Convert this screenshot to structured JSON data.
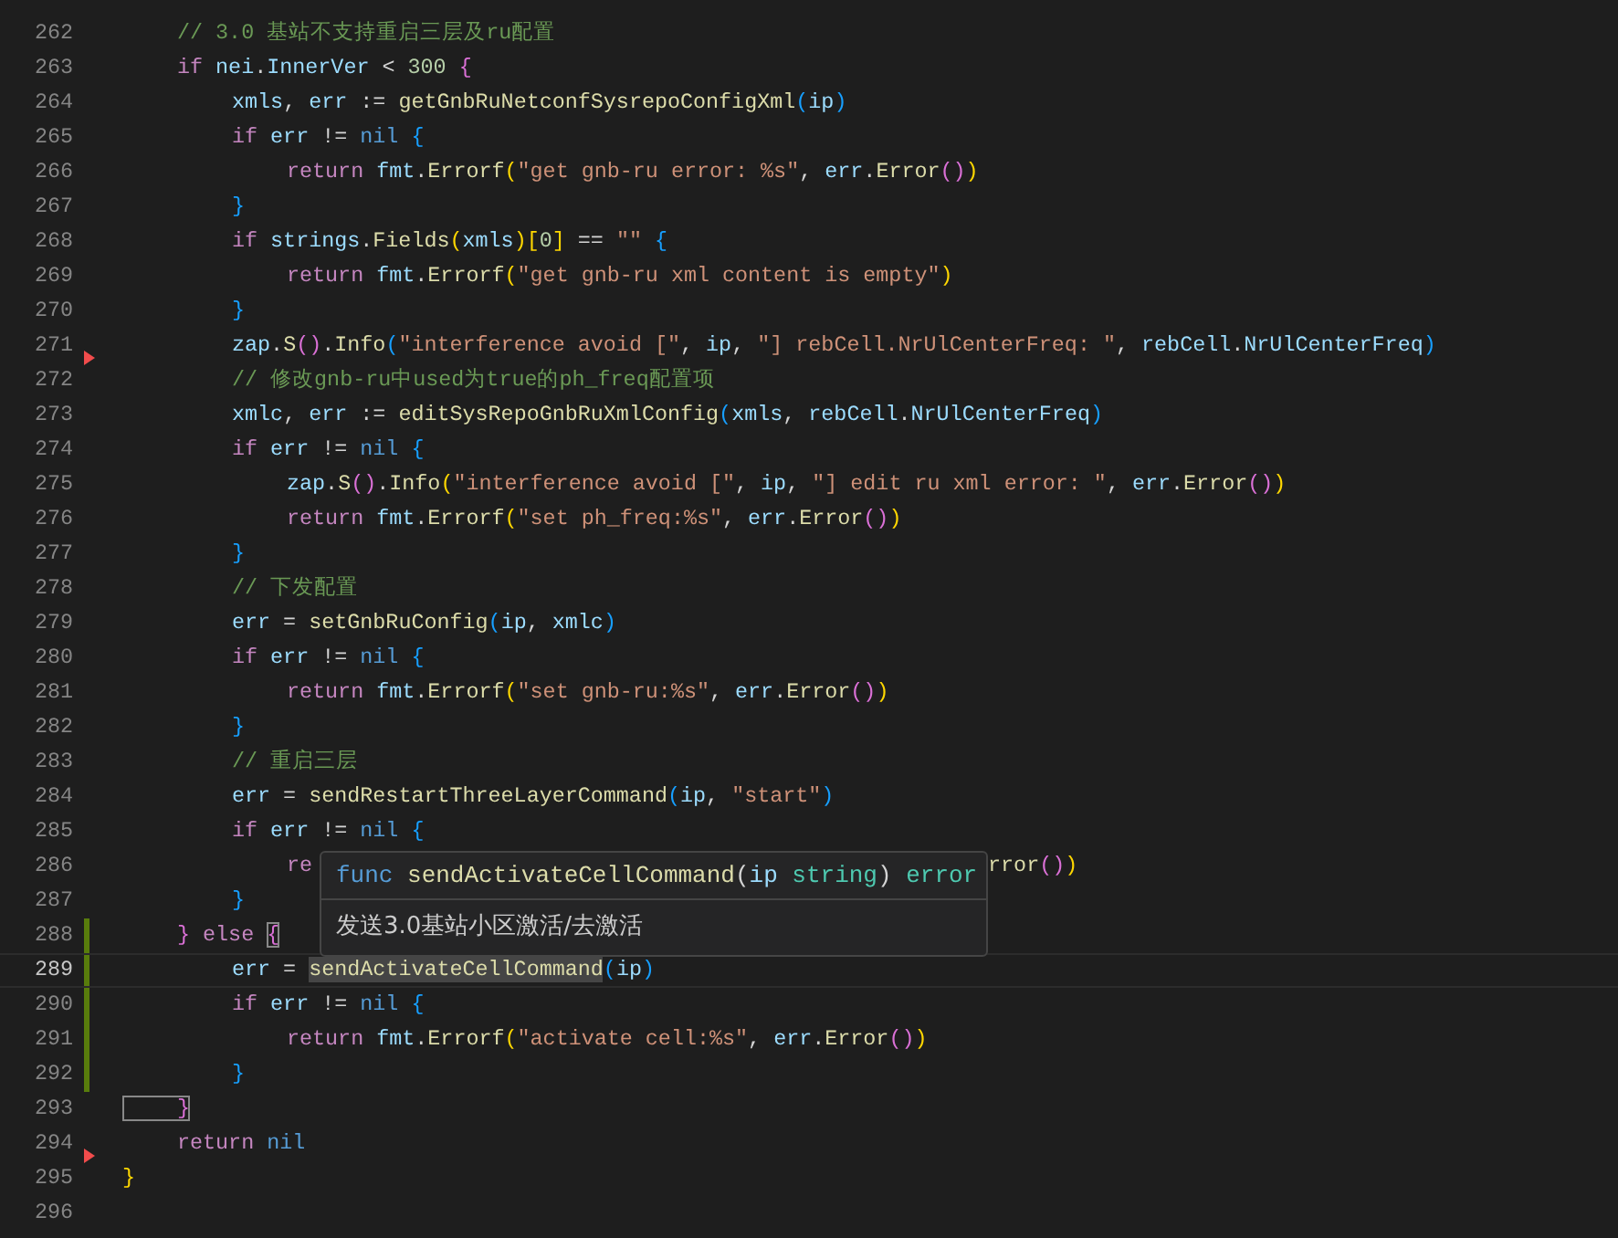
{
  "editor": {
    "lines": [
      {
        "number": "262",
        "current": false,
        "added": false,
        "deleted": false,
        "tokens": [
          {
            "kind": "cmt",
            "text": "\t// 3.0 基站不支持重启三层及ru配置"
          }
        ]
      },
      {
        "number": "263",
        "current": false,
        "added": false,
        "deleted": false,
        "tokens": [
          {
            "kind": "kw",
            "text": "\tif"
          },
          {
            "kind": "var",
            "text": " nei"
          },
          {
            "kind": "op",
            "text": "."
          },
          {
            "kind": "var",
            "text": "InnerVer"
          },
          {
            "kind": "op",
            "text": " < "
          },
          {
            "kind": "num",
            "text": "300"
          },
          {
            "kind": "b2",
            "text": " {"
          }
        ]
      },
      {
        "number": "264",
        "current": false,
        "added": false,
        "deleted": false,
        "tokens": [
          {
            "kind": "var",
            "text": "\t\txmls"
          },
          {
            "kind": "op",
            "text": ", "
          },
          {
            "kind": "var",
            "text": "err"
          },
          {
            "kind": "op",
            "text": " := "
          },
          {
            "kind": "fn",
            "text": "getGnbRuNetconfSysrepoConfigXml"
          },
          {
            "kind": "b3",
            "text": "("
          },
          {
            "kind": "var",
            "text": "ip"
          },
          {
            "kind": "b3",
            "text": ")"
          }
        ]
      },
      {
        "number": "265",
        "current": false,
        "added": false,
        "deleted": false,
        "tokens": [
          {
            "kind": "kw",
            "text": "\t\tif"
          },
          {
            "kind": "var",
            "text": " err"
          },
          {
            "kind": "op",
            "text": " != "
          },
          {
            "kind": "con",
            "text": "nil"
          },
          {
            "kind": "b3",
            "text": " {"
          }
        ]
      },
      {
        "number": "266",
        "current": false,
        "added": false,
        "deleted": false,
        "tokens": [
          {
            "kind": "kw",
            "text": "\t\t\treturn"
          },
          {
            "kind": "var",
            "text": " fmt"
          },
          {
            "kind": "op",
            "text": "."
          },
          {
            "kind": "fn",
            "text": "Errorf"
          },
          {
            "kind": "b1",
            "text": "("
          },
          {
            "kind": "str",
            "text": "\"get gnb-ru error: %s\""
          },
          {
            "kind": "op",
            "text": ", "
          },
          {
            "kind": "var",
            "text": "err"
          },
          {
            "kind": "op",
            "text": "."
          },
          {
            "kind": "fn",
            "text": "Error"
          },
          {
            "kind": "b2",
            "text": "()"
          },
          {
            "kind": "b1",
            "text": ")"
          }
        ]
      },
      {
        "number": "267",
        "current": false,
        "added": false,
        "deleted": false,
        "tokens": [
          {
            "kind": "b3",
            "text": "\t\t}"
          }
        ]
      },
      {
        "number": "268",
        "current": false,
        "added": false,
        "deleted": false,
        "tokens": [
          {
            "kind": "kw",
            "text": "\t\tif"
          },
          {
            "kind": "var",
            "text": " strings"
          },
          {
            "kind": "op",
            "text": "."
          },
          {
            "kind": "fn",
            "text": "Fields"
          },
          {
            "kind": "b1",
            "text": "("
          },
          {
            "kind": "var",
            "text": "xmls"
          },
          {
            "kind": "b1",
            "text": ")["
          },
          {
            "kind": "num",
            "text": "0"
          },
          {
            "kind": "b1",
            "text": "]"
          },
          {
            "kind": "op",
            "text": " == "
          },
          {
            "kind": "str",
            "text": "\"\""
          },
          {
            "kind": "b3",
            "text": " {"
          }
        ]
      },
      {
        "number": "269",
        "current": false,
        "added": false,
        "deleted": false,
        "tokens": [
          {
            "kind": "kw",
            "text": "\t\t\treturn"
          },
          {
            "kind": "var",
            "text": " fmt"
          },
          {
            "kind": "op",
            "text": "."
          },
          {
            "kind": "fn",
            "text": "Errorf"
          },
          {
            "kind": "b1",
            "text": "("
          },
          {
            "kind": "str",
            "text": "\"get gnb-ru xml content is empty\""
          },
          {
            "kind": "b1",
            "text": ")"
          }
        ]
      },
      {
        "number": "270",
        "current": false,
        "added": false,
        "deleted": false,
        "tokens": [
          {
            "kind": "b3",
            "text": "\t\t}"
          }
        ]
      },
      {
        "number": "271",
        "current": false,
        "added": false,
        "deleted": true,
        "tokens": [
          {
            "kind": "var",
            "text": "\t\tzap"
          },
          {
            "kind": "op",
            "text": "."
          },
          {
            "kind": "fn",
            "text": "S"
          },
          {
            "kind": "b2",
            "text": "()"
          },
          {
            "kind": "op",
            "text": "."
          },
          {
            "kind": "fn",
            "text": "Info"
          },
          {
            "kind": "b3",
            "text": "("
          },
          {
            "kind": "str",
            "text": "\"interference avoid [\""
          },
          {
            "kind": "op",
            "text": ", "
          },
          {
            "kind": "var",
            "text": "ip"
          },
          {
            "kind": "op",
            "text": ", "
          },
          {
            "kind": "str",
            "text": "\"] rebCell.NrUlCenterFreq: \""
          },
          {
            "kind": "op",
            "text": ", "
          },
          {
            "kind": "var",
            "text": "rebCell"
          },
          {
            "kind": "op",
            "text": "."
          },
          {
            "kind": "var",
            "text": "NrUlCenterFreq"
          },
          {
            "kind": "b3",
            "text": ")"
          }
        ]
      },
      {
        "number": "272",
        "current": false,
        "added": false,
        "deleted": false,
        "tokens": [
          {
            "kind": "cmt",
            "text": "\t\t// 修改gnb-ru中used为true的ph_freq配置项"
          }
        ]
      },
      {
        "number": "273",
        "current": false,
        "added": false,
        "deleted": false,
        "tokens": [
          {
            "kind": "var",
            "text": "\t\txmlc"
          },
          {
            "kind": "op",
            "text": ", "
          },
          {
            "kind": "var",
            "text": "err"
          },
          {
            "kind": "op",
            "text": " := "
          },
          {
            "kind": "fn",
            "text": "editSysRepoGnbRuXmlConfig"
          },
          {
            "kind": "b3",
            "text": "("
          },
          {
            "kind": "var",
            "text": "xmls"
          },
          {
            "kind": "op",
            "text": ", "
          },
          {
            "kind": "var",
            "text": "rebCell"
          },
          {
            "kind": "op",
            "text": "."
          },
          {
            "kind": "var",
            "text": "NrUlCenterFreq"
          },
          {
            "kind": "b3",
            "text": ")"
          }
        ]
      },
      {
        "number": "274",
        "current": false,
        "added": false,
        "deleted": false,
        "tokens": [
          {
            "kind": "kw",
            "text": "\t\tif"
          },
          {
            "kind": "var",
            "text": " err"
          },
          {
            "kind": "op",
            "text": " != "
          },
          {
            "kind": "con",
            "text": "nil"
          },
          {
            "kind": "b3",
            "text": " {"
          }
        ]
      },
      {
        "number": "275",
        "current": false,
        "added": false,
        "deleted": false,
        "tokens": [
          {
            "kind": "var",
            "text": "\t\t\tzap"
          },
          {
            "kind": "op",
            "text": "."
          },
          {
            "kind": "fn",
            "text": "S"
          },
          {
            "kind": "b2",
            "text": "()"
          },
          {
            "kind": "op",
            "text": "."
          },
          {
            "kind": "fn",
            "text": "Info"
          },
          {
            "kind": "b1",
            "text": "("
          },
          {
            "kind": "str",
            "text": "\"interference avoid [\""
          },
          {
            "kind": "op",
            "text": ", "
          },
          {
            "kind": "var",
            "text": "ip"
          },
          {
            "kind": "op",
            "text": ", "
          },
          {
            "kind": "str",
            "text": "\"] edit ru xml error: \""
          },
          {
            "kind": "op",
            "text": ", "
          },
          {
            "kind": "var",
            "text": "err"
          },
          {
            "kind": "op",
            "text": "."
          },
          {
            "kind": "fn",
            "text": "Error"
          },
          {
            "kind": "b2",
            "text": "()"
          },
          {
            "kind": "b1",
            "text": ")"
          }
        ]
      },
      {
        "number": "276",
        "current": false,
        "added": false,
        "deleted": false,
        "tokens": [
          {
            "kind": "kw",
            "text": "\t\t\treturn"
          },
          {
            "kind": "var",
            "text": " fmt"
          },
          {
            "kind": "op",
            "text": "."
          },
          {
            "kind": "fn",
            "text": "Errorf"
          },
          {
            "kind": "b1",
            "text": "("
          },
          {
            "kind": "str",
            "text": "\"set ph_freq:%s\""
          },
          {
            "kind": "op",
            "text": ", "
          },
          {
            "kind": "var",
            "text": "err"
          },
          {
            "kind": "op",
            "text": "."
          },
          {
            "kind": "fn",
            "text": "Error"
          },
          {
            "kind": "b2",
            "text": "()"
          },
          {
            "kind": "b1",
            "text": ")"
          }
        ]
      },
      {
        "number": "277",
        "current": false,
        "added": false,
        "deleted": false,
        "tokens": [
          {
            "kind": "b3",
            "text": "\t\t}"
          }
        ]
      },
      {
        "number": "278",
        "current": false,
        "added": false,
        "deleted": false,
        "tokens": [
          {
            "kind": "cmt",
            "text": "\t\t// 下发配置"
          }
        ]
      },
      {
        "number": "279",
        "current": false,
        "added": false,
        "deleted": false,
        "tokens": [
          {
            "kind": "var",
            "text": "\t\terr"
          },
          {
            "kind": "op",
            "text": " = "
          },
          {
            "kind": "fn",
            "text": "setGnbRuConfig"
          },
          {
            "kind": "b3",
            "text": "("
          },
          {
            "kind": "var",
            "text": "ip"
          },
          {
            "kind": "op",
            "text": ", "
          },
          {
            "kind": "var",
            "text": "xmlc"
          },
          {
            "kind": "b3",
            "text": ")"
          }
        ]
      },
      {
        "number": "280",
        "current": false,
        "added": false,
        "deleted": false,
        "tokens": [
          {
            "kind": "kw",
            "text": "\t\tif"
          },
          {
            "kind": "var",
            "text": " err"
          },
          {
            "kind": "op",
            "text": " != "
          },
          {
            "kind": "con",
            "text": "nil"
          },
          {
            "kind": "b3",
            "text": " {"
          }
        ]
      },
      {
        "number": "281",
        "current": false,
        "added": false,
        "deleted": false,
        "tokens": [
          {
            "kind": "kw",
            "text": "\t\t\treturn"
          },
          {
            "kind": "var",
            "text": " fmt"
          },
          {
            "kind": "op",
            "text": "."
          },
          {
            "kind": "fn",
            "text": "Errorf"
          },
          {
            "kind": "b1",
            "text": "("
          },
          {
            "kind": "str",
            "text": "\"set gnb-ru:%s\""
          },
          {
            "kind": "op",
            "text": ", "
          },
          {
            "kind": "var",
            "text": "err"
          },
          {
            "kind": "op",
            "text": "."
          },
          {
            "kind": "fn",
            "text": "Error"
          },
          {
            "kind": "b2",
            "text": "()"
          },
          {
            "kind": "b1",
            "text": ")"
          }
        ]
      },
      {
        "number": "282",
        "current": false,
        "added": false,
        "deleted": false,
        "tokens": [
          {
            "kind": "b3",
            "text": "\t\t}"
          }
        ]
      },
      {
        "number": "283",
        "current": false,
        "added": false,
        "deleted": false,
        "tokens": [
          {
            "kind": "cmt",
            "text": "\t\t// 重启三层"
          }
        ]
      },
      {
        "number": "284",
        "current": false,
        "added": false,
        "deleted": false,
        "tokens": [
          {
            "kind": "var",
            "text": "\t\terr"
          },
          {
            "kind": "op",
            "text": " = "
          },
          {
            "kind": "fn",
            "text": "sendRestartThreeLayerCommand"
          },
          {
            "kind": "b3",
            "text": "("
          },
          {
            "kind": "var",
            "text": "ip"
          },
          {
            "kind": "op",
            "text": ", "
          },
          {
            "kind": "str",
            "text": "\"start\""
          },
          {
            "kind": "b3",
            "text": ")"
          }
        ]
      },
      {
        "number": "285",
        "current": false,
        "added": false,
        "deleted": false,
        "tokens": [
          {
            "kind": "kw",
            "text": "\t\tif"
          },
          {
            "kind": "var",
            "text": " err"
          },
          {
            "kind": "op",
            "text": " != "
          },
          {
            "kind": "con",
            "text": "nil"
          },
          {
            "kind": "b3",
            "text": " {"
          }
        ]
      },
      {
        "number": "286",
        "current": false,
        "added": false,
        "deleted": false,
        "tokens": [
          {
            "kind": "kw",
            "text": "\t\t\tre"
          }
        ],
        "tail": [
          {
            "kind": "fn",
            "text": "rror"
          },
          {
            "kind": "b2",
            "text": "()"
          },
          {
            "kind": "b1",
            "text": ")"
          }
        ]
      },
      {
        "number": "287",
        "current": false,
        "added": false,
        "deleted": false,
        "tokens": [
          {
            "kind": "b3",
            "text": "\t\t}"
          }
        ]
      },
      {
        "number": "288",
        "current": false,
        "added": true,
        "deleted": false,
        "tokens": [
          {
            "kind": "b2",
            "text": "\t}"
          },
          {
            "kind": "kw",
            "text": " else "
          },
          {
            "kind": "b2",
            "text": "{",
            "bracket_match": true
          }
        ]
      },
      {
        "number": "289",
        "current": true,
        "added": true,
        "deleted": false,
        "tokens": [
          {
            "kind": "var",
            "text": "\t\terr"
          },
          {
            "kind": "op",
            "text": " = "
          },
          {
            "kind": "fn",
            "text": "sendActivateCellCommand",
            "selection_match": true
          },
          {
            "kind": "b3",
            "text": "("
          },
          {
            "kind": "var",
            "text": "ip"
          },
          {
            "kind": "b3",
            "text": ")"
          }
        ]
      },
      {
        "number": "290",
        "current": false,
        "added": true,
        "deleted": false,
        "tokens": [
          {
            "kind": "kw",
            "text": "\t\tif"
          },
          {
            "kind": "var",
            "text": " err"
          },
          {
            "kind": "op",
            "text": " != "
          },
          {
            "kind": "con",
            "text": "nil"
          },
          {
            "kind": "b3",
            "text": " {"
          }
        ]
      },
      {
        "number": "291",
        "current": false,
        "added": true,
        "deleted": false,
        "tokens": [
          {
            "kind": "kw",
            "text": "\t\t\treturn"
          },
          {
            "kind": "var",
            "text": " fmt"
          },
          {
            "kind": "op",
            "text": "."
          },
          {
            "kind": "fn",
            "text": "Errorf"
          },
          {
            "kind": "b1",
            "text": "("
          },
          {
            "kind": "str",
            "text": "\"activate cell:%s\""
          },
          {
            "kind": "op",
            "text": ", "
          },
          {
            "kind": "var",
            "text": "err"
          },
          {
            "kind": "op",
            "text": "."
          },
          {
            "kind": "fn",
            "text": "Error"
          },
          {
            "kind": "b2",
            "text": "()"
          },
          {
            "kind": "b1",
            "text": ")"
          }
        ]
      },
      {
        "number": "292",
        "current": false,
        "added": true,
        "deleted": false,
        "tokens": [
          {
            "kind": "b3",
            "text": "\t\t}"
          }
        ]
      },
      {
        "number": "293",
        "current": false,
        "added": false,
        "deleted": false,
        "tokens": [
          {
            "kind": "b2",
            "text": "\t}",
            "bracket_match": true
          }
        ]
      },
      {
        "number": "294",
        "current": false,
        "added": false,
        "deleted": true,
        "tokens": [
          {
            "kind": "kw",
            "text": "\treturn"
          },
          {
            "kind": "con",
            "text": " nil"
          }
        ]
      },
      {
        "number": "295",
        "current": false,
        "added": false,
        "deleted": false,
        "tokens": [
          {
            "kind": "b1",
            "text": "}"
          }
        ]
      },
      {
        "number": "296",
        "current": false,
        "added": false,
        "deleted": false
      }
    ],
    "hover": {
      "signature": [
        {
          "kind": "decl",
          "text": "func"
        },
        {
          "kind": "fn",
          "text": " sendActivateCellCommand"
        },
        {
          "kind": "op",
          "text": "("
        },
        {
          "kind": "var",
          "text": "ip"
        },
        {
          "kind": "type",
          "text": " string"
        },
        {
          "kind": "op",
          "text": ") "
        },
        {
          "kind": "type",
          "text": "error"
        }
      ],
      "doc": "发送3.0基站小区激活/去激活"
    }
  }
}
